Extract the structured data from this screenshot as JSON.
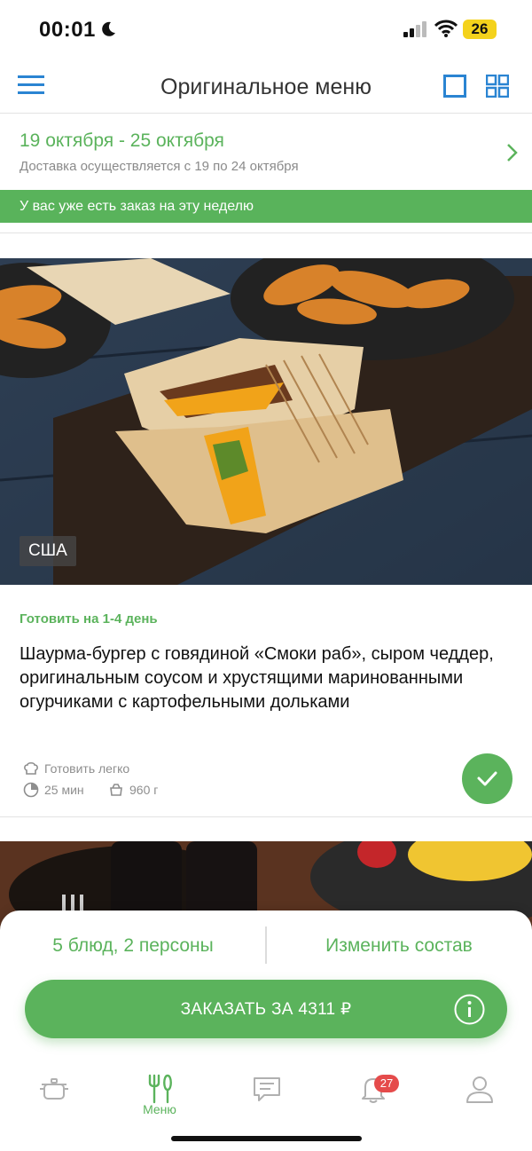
{
  "status_bar": {
    "time": "00:01",
    "battery": "26"
  },
  "header": {
    "title": "Оригинальное меню"
  },
  "week": {
    "range": "19 октября - 25 октября",
    "delivery": "Доставка осуществляется с 19 по 24 октября"
  },
  "notice": "У вас уже есть заказ на эту неделю",
  "dish": {
    "country": "США",
    "cook_period": "Готовить на 1-4 день",
    "title": "Шаурма-бургер с говядиной «Смоки раб», сыром чеддер, оригинальным соусом и хрустящими маринованными огурчиками с картофельными дольками",
    "difficulty": "Готовить легко",
    "time": "25 мин",
    "weight": "960 г",
    "selected": true
  },
  "order_panel": {
    "dishes_count": "5 блюд, 2 персоны",
    "change_set": "Изменить состав",
    "order_button": "ЗАКАЗАТЬ ЗА 4311 ₽"
  },
  "tabbar": {
    "active": "menu",
    "menu_label": "Меню",
    "notifications_count": "27"
  },
  "colors": {
    "accent": "#5bb35c",
    "badge": "#e54b4b",
    "text_secondary": "#8e8e8e"
  },
  "icons": [
    "moon-icon",
    "signal-icon",
    "wifi-icon",
    "hamburger-menu-icon",
    "single-view-icon",
    "grid-view-icon",
    "chevron-right-icon",
    "chef-hat-icon",
    "clock-icon",
    "box-icon",
    "check-icon",
    "info-icon",
    "pot-icon",
    "fork-knife-icon",
    "chat-icon",
    "bell-icon",
    "user-icon"
  ]
}
